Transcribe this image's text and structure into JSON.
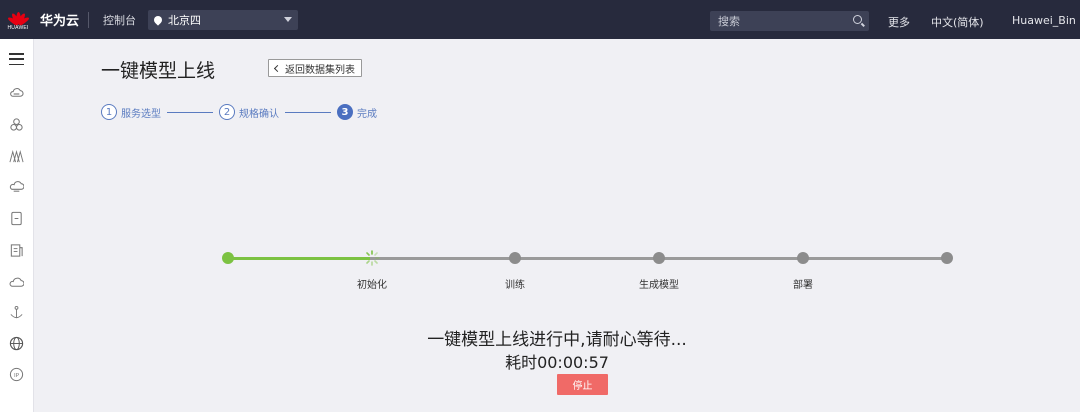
{
  "topbar": {
    "logo_text": "HUAWEI",
    "brand": "华为云",
    "console": "控制台",
    "region": "北京四",
    "search_placeholder": "搜索",
    "more": "更多",
    "language": "中文(简体)",
    "user": "Huawei_Bin"
  },
  "page": {
    "title": "一键模型上线",
    "back_button": "返回数据集列表"
  },
  "steps": [
    {
      "num": "1",
      "label": "服务选型"
    },
    {
      "num": "2",
      "label": "规格确认"
    },
    {
      "num": "3",
      "label": "完成"
    }
  ],
  "progress": {
    "stages": [
      "初始化",
      "训练",
      "生成模型",
      "部署"
    ],
    "status": "一键模型上线进行中,请耐心等待...",
    "elapsed": "耗时00:00:57",
    "stop_button": "停止"
  },
  "colors": {
    "topbar": "#272a3d",
    "accent": "#4a6fc0",
    "done": "#7cc242",
    "pending": "#8c8c8c",
    "stop": "#f06a67"
  },
  "sidebar_icons": [
    "menu-icon",
    "cloud-icon",
    "cluster-icon",
    "network-icon",
    "database-icon",
    "document-icon",
    "file-icon",
    "cloud-outline-icon",
    "anchor-icon",
    "globe-icon",
    "ip-icon"
  ]
}
